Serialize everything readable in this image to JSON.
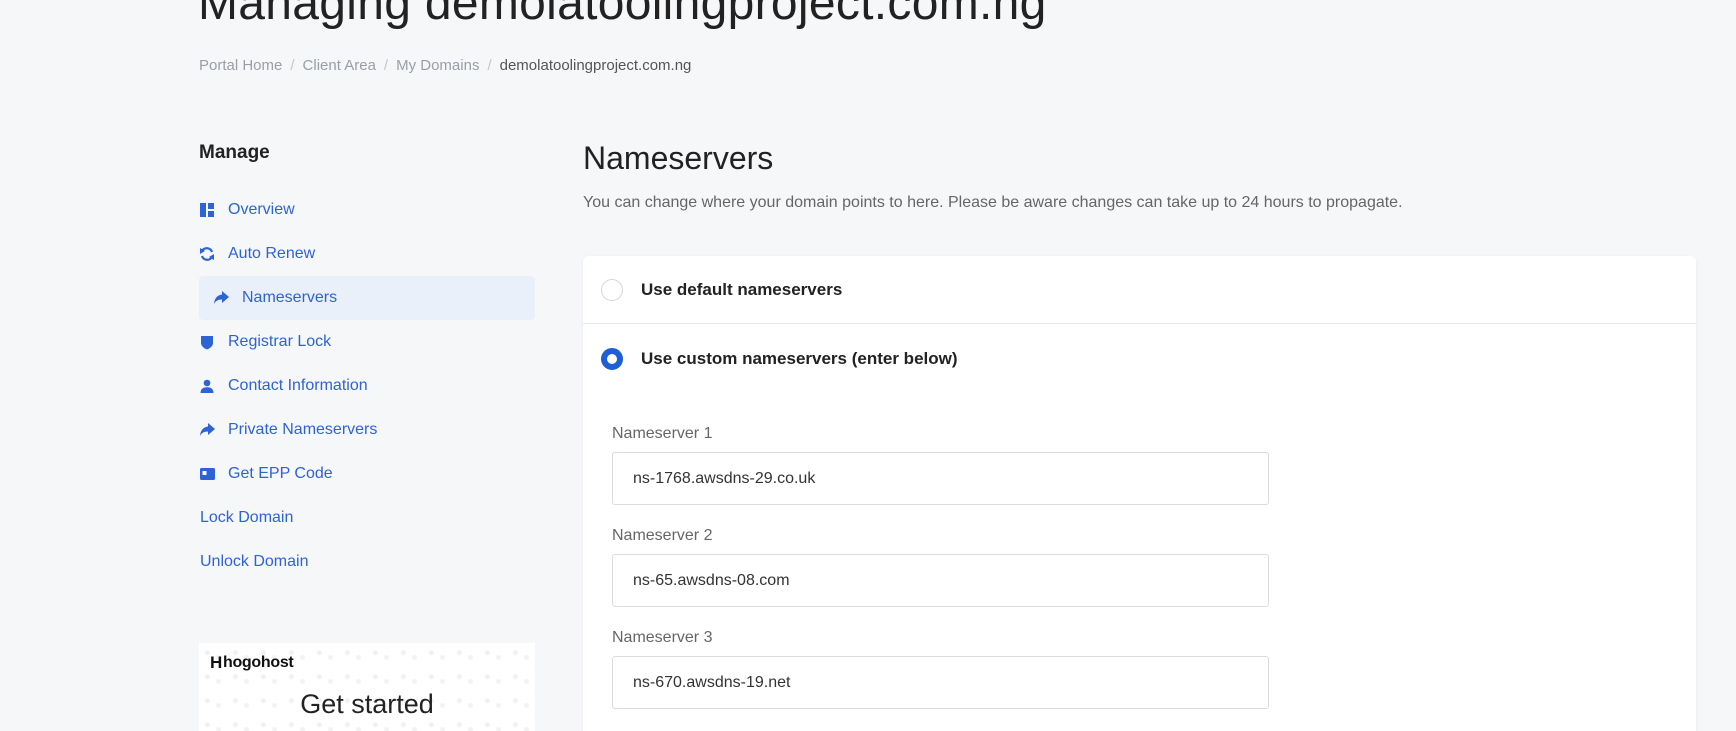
{
  "page": {
    "title": "Managing demolatoolingproject.com.ng"
  },
  "breadcrumb": [
    {
      "label": "Portal Home"
    },
    {
      "label": "Client Area"
    },
    {
      "label": "My Domains"
    },
    {
      "label": "demolatoolingproject.com.ng"
    }
  ],
  "sidebar": {
    "heading": "Manage",
    "items": [
      {
        "label": "Overview",
        "icon": "dashboard-icon"
      },
      {
        "label": "Auto Renew",
        "icon": "sync-icon"
      },
      {
        "label": "Nameservers",
        "icon": "share-arrow-icon",
        "active": true
      },
      {
        "label": "Registrar Lock",
        "icon": "shield-icon"
      },
      {
        "label": "Contact Information",
        "icon": "user-icon"
      },
      {
        "label": "Private Nameservers",
        "icon": "share-arrow-icon"
      },
      {
        "label": "Get EPP Code",
        "icon": "id-card-icon"
      },
      {
        "label": "Lock Domain"
      },
      {
        "label": "Unlock Domain"
      }
    ]
  },
  "promo": {
    "logo": "hogohost",
    "logo_mark": "H",
    "cta": "Get started"
  },
  "main": {
    "title": "Nameservers",
    "description": "You can change where your domain points to here. Please be aware changes can take up to 24 hours to propagate.",
    "options": [
      {
        "label": "Use default nameservers",
        "checked": false
      },
      {
        "label": "Use custom nameservers (enter below)",
        "checked": true
      }
    ],
    "nameservers": [
      {
        "label": "Nameserver 1",
        "value": "ns-1768.awsdns-29.co.uk"
      },
      {
        "label": "Nameserver 2",
        "value": "ns-65.awsdns-08.com"
      },
      {
        "label": "Nameserver 3",
        "value": "ns-670.awsdns-19.net"
      }
    ]
  },
  "colors": {
    "accent": "#1f5fd6",
    "link": "#2e63d6",
    "background": "#f6f7f9",
    "active_bg": "#eaf0fa"
  }
}
